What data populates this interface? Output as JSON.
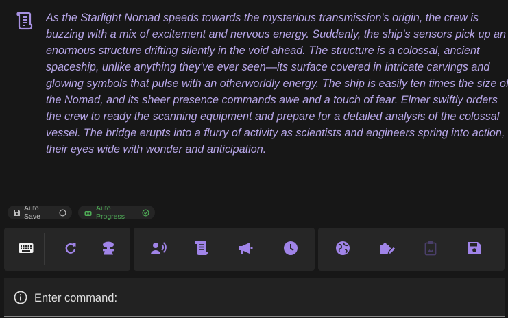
{
  "story": {
    "icon": "scroll-icon",
    "lines": [
      "As the Starlight Nomad speeds towards the mysterious transmission's origin, the crew is",
      "buzzing with a mix of excitement and nervous energy. Suddenly, the ship's sensors pick up an",
      "enormous structure drifting silently in the void ahead. The structure is a colossal, ancient",
      "spaceship, unlike anything they've ever seen—its surface covered in intricate carvings and",
      "glowing symbols that pulse with an otherworldly energy. The ship is easily ten times the size of",
      "the Nomad, and its sheer presence commands awe and a touch of fear. Elmer swiftly orders",
      "the crew to ready the scanning equipment and prepare for a detailed analysis of the colossal",
      "vessel. The bridge erupts into a flurry of activity as scientists and engineers spring into action,",
      "their eyes wide with wonder and anticipation."
    ]
  },
  "toggles": {
    "auto_save": {
      "label": "Auto Save",
      "icon": "floppy-icon",
      "state_icon": "empty-circle-icon",
      "enabled": false
    },
    "auto_progress": {
      "label": "Auto Progress",
      "icon": "robot-icon",
      "state_icon": "check-circle-icon",
      "enabled": true
    }
  },
  "toolbar": {
    "groups": [
      {
        "buttons": [
          "keyboard-icon",
          "retry-icon",
          "brain-icon"
        ]
      },
      {
        "buttons": [
          "speaker-icon",
          "story-icon",
          "megaphone-icon",
          "clock-icon"
        ]
      },
      {
        "buttons": [
          "globe-icon",
          "puzzle-edit-icon",
          "clipboard-image-icon",
          "save-icon"
        ]
      }
    ]
  },
  "command": {
    "placeholder": "Enter command:",
    "icon": "info-icon"
  },
  "colors": {
    "background": "#171717",
    "panel": "#262626",
    "accent": "#a084e8",
    "story_text": "#b7a6e8",
    "progress_green": "#4fae57"
  }
}
